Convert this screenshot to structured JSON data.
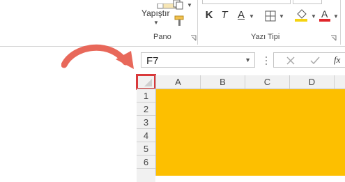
{
  "ribbon": {
    "clipboard": {
      "paste_label": "Yapıştır",
      "group_label": "Pano"
    },
    "font": {
      "bold_label": "K",
      "italic_label": "T",
      "underline_label": "A",
      "group_label": "Yazı Tipi"
    }
  },
  "formula_bar": {
    "name_box_value": "F7",
    "cancel_icon": "x-icon",
    "enter_icon": "check-icon",
    "function_label": "fx"
  },
  "grid": {
    "columns": [
      "A",
      "B",
      "C",
      "D"
    ],
    "rows": [
      "1",
      "2",
      "3",
      "4",
      "5",
      "6"
    ]
  },
  "colors": {
    "selection_fill": "#fdbf00",
    "highlight_border": "#d9393b",
    "arrow": "#e8685a",
    "fill_color_bar": "#f5d311",
    "font_color_bar": "#e0262b"
  }
}
